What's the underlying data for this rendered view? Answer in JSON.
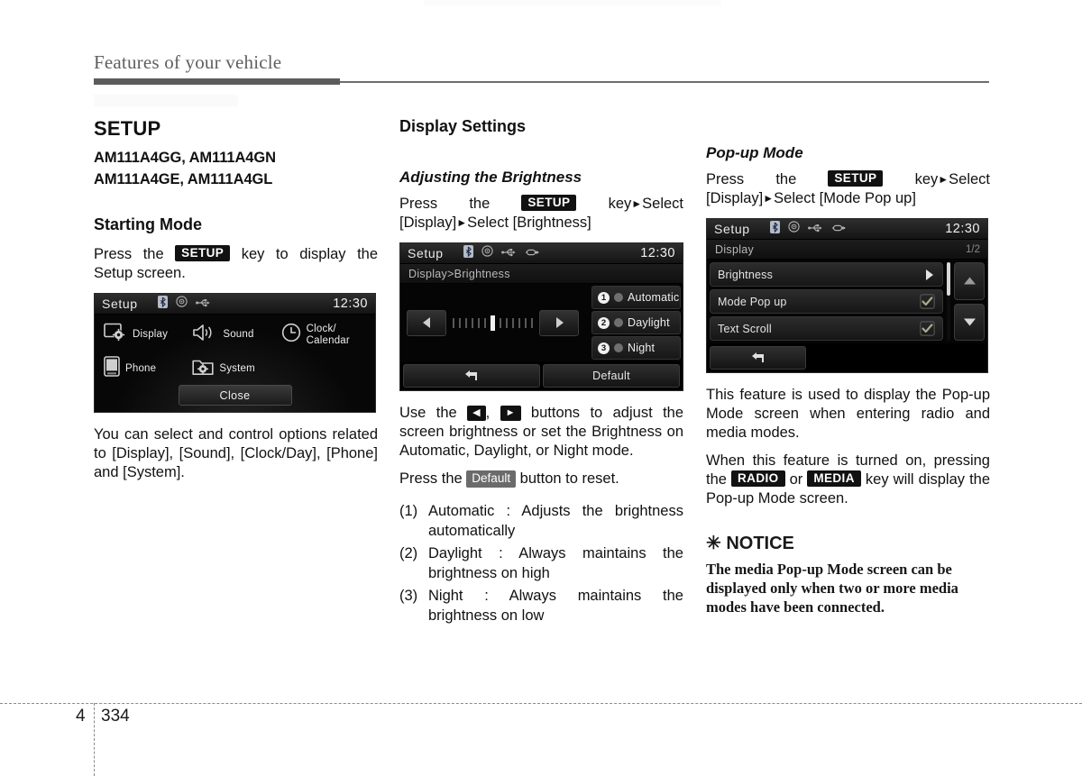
{
  "header": {
    "running_head": "Features of your vehicle"
  },
  "footer": {
    "chapter": "4",
    "page": "334"
  },
  "col1": {
    "section_title": "SETUP",
    "model_line_1": "AM111A4GG, AM111A4GN",
    "model_line_2": "AM111A4GE, AM111A4GL",
    "starting_mode_title": "Starting Mode",
    "press_pre": "Press the",
    "setup_key": "SETUP",
    "press_post": "key to display the Setup screen.",
    "body": "You can select and control options related to [Display], [Sound], [Clock/Day],  [Phone] and [System].",
    "screen": {
      "title": "Setup",
      "clock": "12:30",
      "icons": [
        "bluetooth-icon",
        "disc-icon",
        "usb-icon"
      ],
      "items": [
        {
          "label": "Display",
          "icon": "display-gear-icon"
        },
        {
          "label": "Sound",
          "icon": "speaker-icon"
        },
        {
          "label": "Clock/\nCalendar",
          "icon": "clock-icon"
        },
        {
          "label": "Phone",
          "icon": "phone-icon"
        },
        {
          "label": "System",
          "icon": "folder-gear-icon"
        }
      ],
      "close_label": "Close"
    }
  },
  "col2": {
    "section_title": "Display Settings",
    "adjusting_title": "Adjusting the Brightness",
    "press_pre": "Press   the",
    "setup_key": "SETUP",
    "press_post_1": "key",
    "press_post_2": "Select [Display]",
    "press_post_3": "Select [Brightness]",
    "screen": {
      "title": "Setup",
      "clock": "12:30",
      "icons": [
        "bluetooth-icon",
        "disc-icon",
        "usb-icon",
        "aux-icon"
      ],
      "breadcrumb": "Display>Brightness",
      "tick_count": 13,
      "tick_active_index": 6,
      "options": [
        {
          "num": "1",
          "label": "Automatic"
        },
        {
          "num": "2",
          "label": "Daylight"
        },
        {
          "num": "3",
          "label": "Night"
        }
      ],
      "back_label": "",
      "default_label": "Default"
    },
    "use_text_1": "Use the",
    "use_text_2": ",",
    "use_text_3": "buttons to adjust the screen brightness or set the Brightness on Automatic, Daylight, or Night mode.",
    "press_default_1": "Press the",
    "default_chip": "Default",
    "press_default_2": "button to reset.",
    "list": [
      {
        "num": "(1)",
        "text": "Automatic : Adjusts the brightness automatically"
      },
      {
        "num": "(2)",
        "text": "Daylight : Always maintains the brightness on high"
      },
      {
        "num": "(3)",
        "text": "Night : Always maintains the brightness on low"
      }
    ]
  },
  "col3": {
    "popup_title": "Pop-up Mode",
    "press_pre": "Press    the",
    "setup_key": "SETUP",
    "press_post_1": "key",
    "press_post_2": "Select [Display]",
    "press_post_3": "Select [Mode Pop up]",
    "screen": {
      "title": "Setup",
      "clock": "12:30",
      "icons": [
        "bluetooth-icon",
        "disc-icon",
        "usb-icon",
        "aux-icon"
      ],
      "breadcrumb": "Display",
      "page_indicator": "1/2",
      "rows": [
        {
          "label": "Brightness",
          "control": "arrow"
        },
        {
          "label": "Mode Pop up",
          "control": "check"
        },
        {
          "label": "Text Scroll",
          "control": "check"
        }
      ]
    },
    "para1": "This feature is used to display the Pop-up Mode screen when entering radio and media modes.",
    "para2_1": "When this feature is turned on, pressing the",
    "radio_key": "RADIO",
    "para2_2": "or",
    "media_key": "MEDIA",
    "para2_3": "key will display the Pop-up Mode screen.",
    "notice_title": "NOTICE",
    "notice_marker": "✳",
    "notice_body": "The media Pop-up Mode screen can be displayed only when two or more media modes have been connected."
  }
}
